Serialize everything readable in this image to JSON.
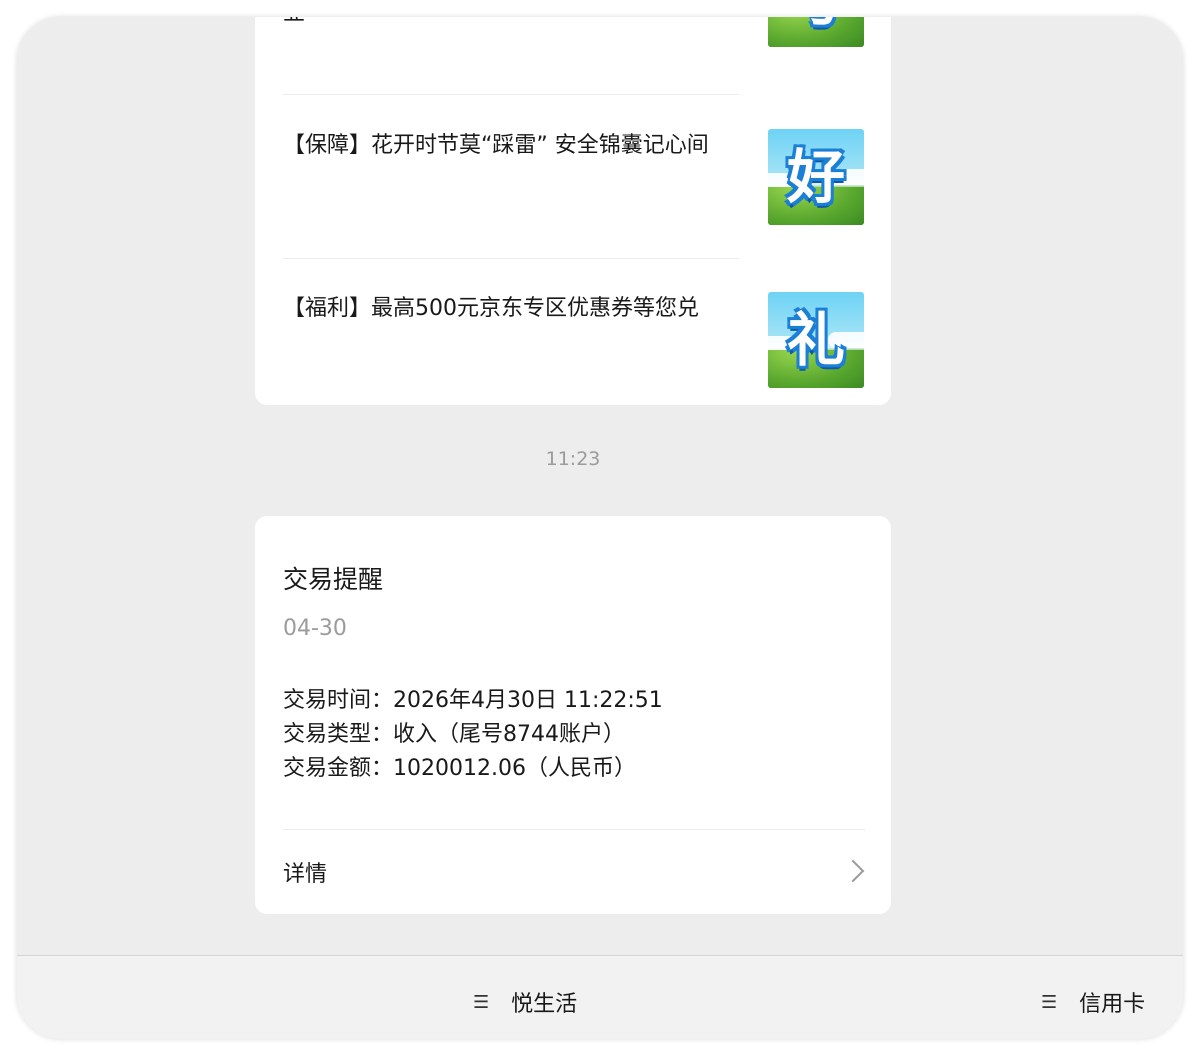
{
  "news": [
    {
      "text": "业",
      "glyph": "号"
    },
    {
      "text": "【保障】花开时节莫“踩雷” 安全锦囊记心间",
      "glyph": "好"
    },
    {
      "text": "【福利】最高500元京东专区优惠券等您兑",
      "glyph": "礼"
    }
  ],
  "timestamp": "11:23",
  "transaction": {
    "title": "交易提醒",
    "date": "04-30",
    "time_line": "交易时间：2026年4月30日 11:22:51",
    "type_line": "交易类型：收入（尾号8744账户）",
    "amount_line": "交易金额：1020012.06（人民币）",
    "detail_label": "详情"
  },
  "bottom_menu": [
    {
      "icon": "hamburger-icon",
      "label": "悦生活"
    },
    {
      "icon": "hamburger-icon",
      "label": "信用卡"
    }
  ],
  "colors": {
    "background": "#ededed",
    "card": "#ffffff",
    "muted_text": "#9b9b9b"
  }
}
